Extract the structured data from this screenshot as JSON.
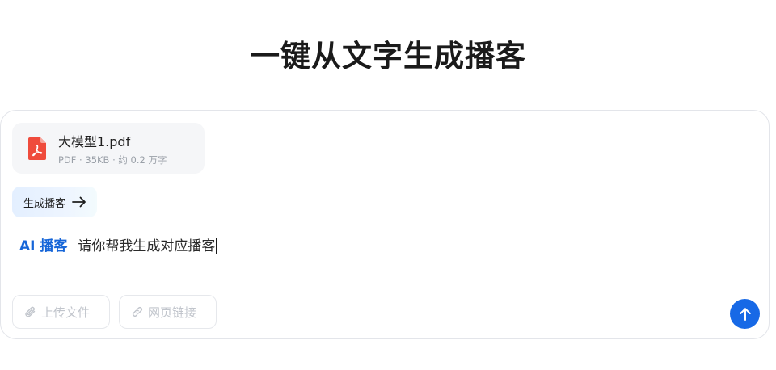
{
  "page": {
    "title": "一键从文字生成播客"
  },
  "file": {
    "name": "大模型1.pdf",
    "meta": "PDF · 35KB · 约 0.2 万字",
    "icon": "pdf-file-icon"
  },
  "chip": {
    "label": "生成播客",
    "icon": "arrow-right-icon"
  },
  "prompt": {
    "tag": "AI 播客",
    "value": "请你帮我生成对应播客"
  },
  "toolbar": {
    "upload_label": "上传文件",
    "upload_icon": "paperclip-icon",
    "link_label": "网页链接",
    "link_icon": "link-icon",
    "send_icon": "arrow-up-icon"
  },
  "colors": {
    "accent": "#1769e6",
    "tag": "#1565d8",
    "pdf": "#ef4b3c"
  }
}
